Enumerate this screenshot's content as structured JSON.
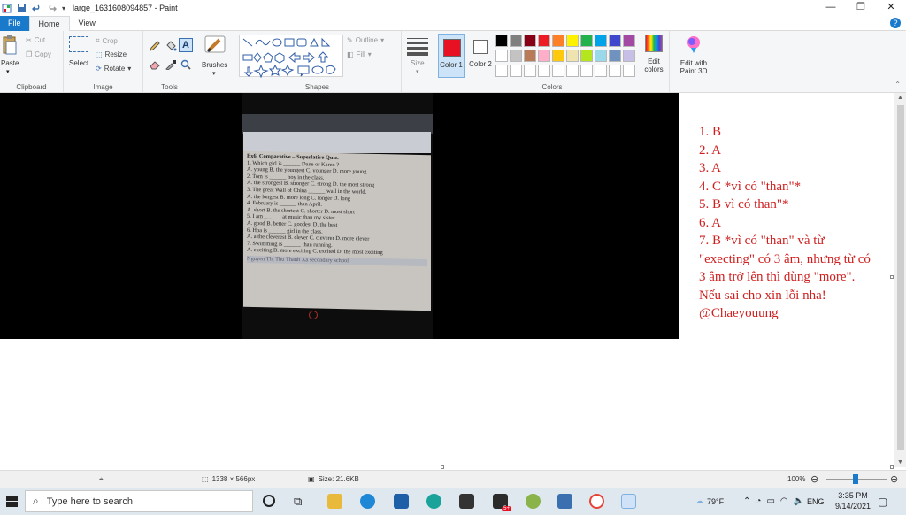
{
  "window": {
    "title": "large_1631608094857 - Paint",
    "controls": {
      "minimize": "—",
      "maximize": "❐",
      "close": "✕"
    }
  },
  "tabs": [
    {
      "label": "File"
    },
    {
      "label": "Home"
    },
    {
      "label": "View"
    }
  ],
  "ribbon": {
    "clipboard": {
      "paste": "Paste",
      "cut": "Cut",
      "copy": "Copy",
      "group": "Clipboard"
    },
    "image": {
      "select": "Select",
      "crop": "Crop",
      "resize": "Resize",
      "rotate": "Rotate",
      "group": "Image"
    },
    "tools": {
      "group": "Tools",
      "brushes": "Brushes"
    },
    "shapes": {
      "outline": "Outline",
      "fill": "Fill",
      "group": "Shapes"
    },
    "size": {
      "label": "Size"
    },
    "colors": {
      "color1": "Color 1",
      "color2": "Color 2",
      "edit": "Edit colors",
      "paint3d": "Edit with Paint 3D",
      "group": "Colors",
      "color1_value": "#e81123",
      "color2_value": "#ffffff",
      "palette_row1": [
        "#000000",
        "#7f7f7f",
        "#880015",
        "#ed1c24",
        "#ff7f27",
        "#fff200",
        "#22b14c",
        "#00a2e8",
        "#3f48cc",
        "#a349a4"
      ],
      "palette_row2": [
        "#ffffff",
        "#c3c3c3",
        "#b97a57",
        "#ffaec9",
        "#ffc90e",
        "#efe4b0",
        "#b5e61d",
        "#99d9ea",
        "#7092be",
        "#c8bfe7"
      ]
    }
  },
  "photo": {
    "lines": [
      "Ex6. Comparative – Superlative Quiz.",
      "1. Which girl is ______ Dane or Karen ?",
      "A. young   B. the youngest  C. younger  D. more young",
      "2. Tom is ______ boy in the class.",
      "A. the strongest  B. stronger  C. strong  D. the most strong",
      "3. The great Wall of China ______ wall in the world.",
      "A. the longest  B. more long  C. longer  D. long",
      "4. February is ______ than April.",
      "A. short  B. the shortest  C. shorter  D. most short",
      "5. I am ______ at music than my sister.",
      "A. good  B. better  C. goodest  D. the best",
      "6. Hoa is ______ girl in the class.",
      "A. a the cleverest  B. clever  C. cleverer  D. more clever",
      "7. Swimming is ______ than running.",
      "A. exciting  B. more exciting  C. excited  D. the most exciting"
    ],
    "footer": "Nguyen Thi Thu Thanh Xa secondary school"
  },
  "notes": [
    "1. B",
    "2. A",
    "3. A",
    "4. C *vì có \"than\"*",
    "5. B vì có than\"*",
    "6. A",
    "7. B *vì có \"than\" và từ \"execting\" có 3 âm, nhưng từ có 3 âm trở lên thì dùng \"more\".",
    "Nếu sai cho xin lỗi nha!",
    "@Chaeyouung"
  ],
  "statusbar": {
    "dimensions": "1338 × 566px",
    "size": "Size: 21.6KB",
    "zoom": "100%"
  },
  "taskbar": {
    "search_placeholder": "Type here to search",
    "weather": "79°F",
    "lang": "ENG",
    "time": "3:35 PM",
    "date": "9/14/2021",
    "badge": "5+"
  }
}
